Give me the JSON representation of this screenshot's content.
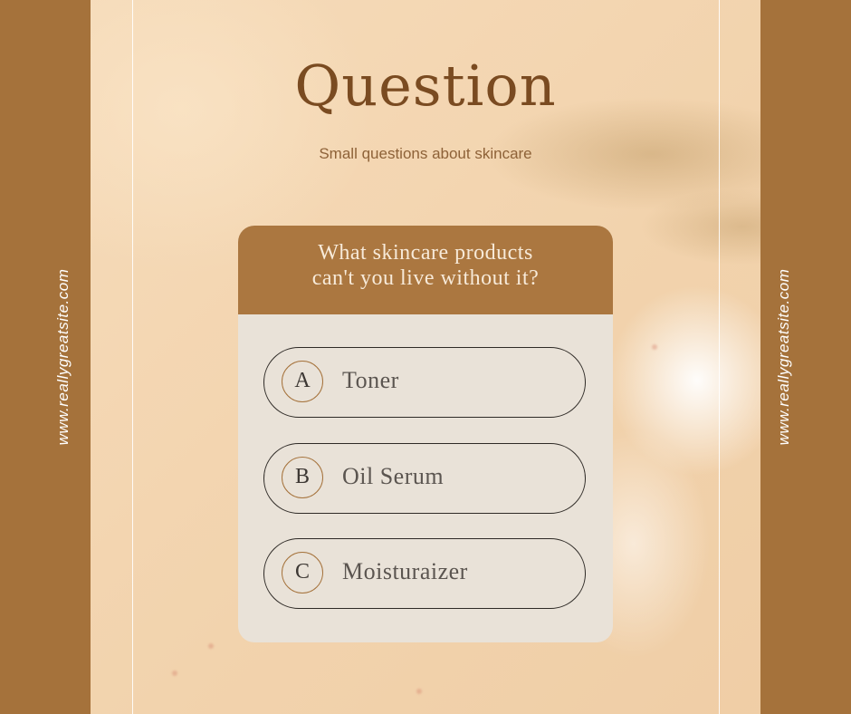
{
  "side_url_left": "www.reallygreatsite.com",
  "side_url_right": "www.reallygreatsite.com",
  "title": "Question",
  "subtitle": "Small questions about skincare",
  "question": {
    "line1": "What skincare products",
    "line2": "can't you live without it?"
  },
  "options": [
    {
      "letter": "A",
      "label": "Toner"
    },
    {
      "letter": "B",
      "label": "Oil Serum"
    },
    {
      "letter": "C",
      "label": "Moisturaizer"
    }
  ],
  "colors": {
    "band": "#a5723b",
    "background": "#f4d9b6",
    "card": "#e9e2d8",
    "card_header": "#ab7740",
    "title": "#7a4b21"
  }
}
